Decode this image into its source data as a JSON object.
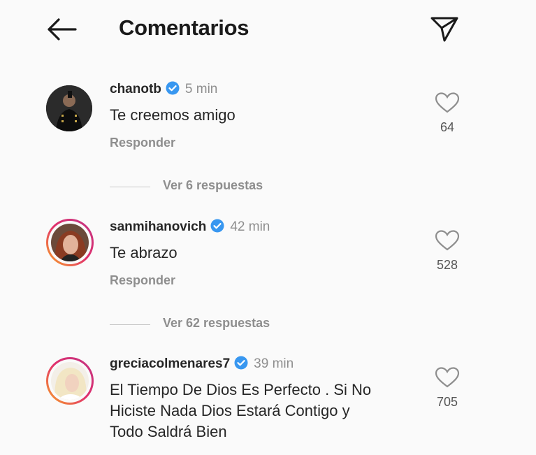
{
  "header": {
    "title": "Comentarios",
    "back_icon": "arrow-left-icon",
    "send_icon": "paper-plane-icon"
  },
  "colors": {
    "verified": "#3897f0",
    "story_ring": [
      "#f9a825",
      "#e1306c",
      "#c13584"
    ],
    "muted": "#8e8e8e"
  },
  "comments": [
    {
      "username": "chanotb",
      "verified": true,
      "time": "5 min",
      "text": [
        "Te creemos amigo"
      ],
      "reply_label": "Responder",
      "likes": "64",
      "view_replies": "Ver 6 respuestas"
    },
    {
      "username": "sanmihanovich",
      "verified": true,
      "time": "42 min",
      "text": [
        "Te abrazo"
      ],
      "reply_label": "Responder",
      "likes": "528",
      "view_replies": "Ver 62 respuestas"
    },
    {
      "username": "greciacolmenares7",
      "verified": true,
      "time": "39 min",
      "text": [
        "El Tiempo De Dios Es Perfecto . Si No",
        "Hiciste Nada Dios Estará  Contigo y",
        "Todo  Saldrá Bien"
      ],
      "likes": "705"
    }
  ]
}
